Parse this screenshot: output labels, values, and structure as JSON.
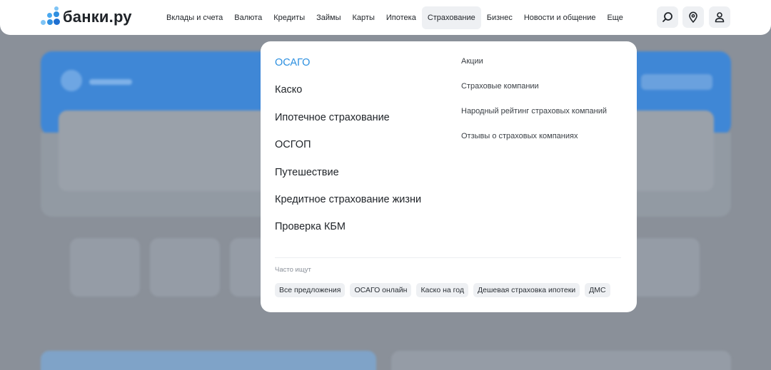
{
  "header": {
    "logo_text": "банки.ру",
    "nav": [
      {
        "label": "Вклады и счета",
        "active": false
      },
      {
        "label": "Валюта",
        "active": false
      },
      {
        "label": "Кредиты",
        "active": false
      },
      {
        "label": "Займы",
        "active": false
      },
      {
        "label": "Карты",
        "active": false
      },
      {
        "label": "Ипотека",
        "active": false
      },
      {
        "label": "Страхование",
        "active": true
      },
      {
        "label": "Бизнес",
        "active": false
      },
      {
        "label": "Новости и общение",
        "active": false
      },
      {
        "label": "Еще",
        "active": false
      }
    ],
    "icons": [
      "search-icon",
      "location-pin-icon",
      "user-icon"
    ]
  },
  "menu": {
    "main_items": [
      {
        "label": "ОСАГО",
        "active": true
      },
      {
        "label": "Каско",
        "active": false
      },
      {
        "label": "Ипотечное страхование",
        "active": false
      },
      {
        "label": "ОСГОП",
        "active": false
      },
      {
        "label": "Путешествие",
        "active": false
      },
      {
        "label": "Кредитное страхование жизни",
        "active": false
      },
      {
        "label": "Проверка КБМ",
        "active": false
      }
    ],
    "side_items": [
      "Акции",
      "Страховые компании",
      "Народный рейтинг страховых компаний",
      "Отзывы о страховых компаниях"
    ],
    "frequent_label": "Часто ищут",
    "frequent_chips": [
      "Все предложения",
      "ОСАГО онлайн",
      "Каско на год",
      "Дешевая страховка ипотеки",
      "ДМС"
    ]
  },
  "colors": {
    "accent": "#2b8fe0",
    "overlay": "#8a9099",
    "brand_blue": "#3f87d6"
  }
}
